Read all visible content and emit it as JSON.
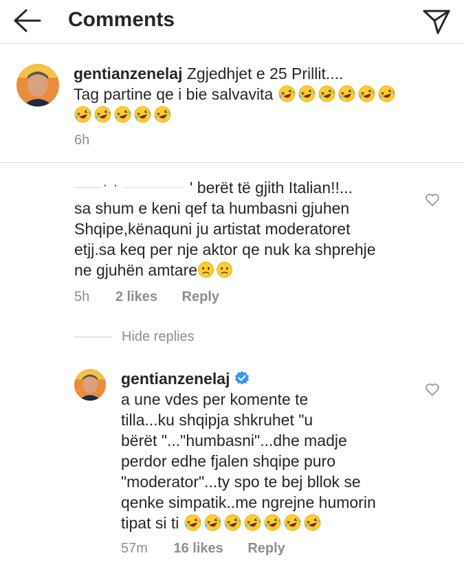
{
  "header": {
    "title": "Comments",
    "back_icon": "back-arrow-icon",
    "share_icon": "direct-send-icon"
  },
  "caption": {
    "username": "gentianzenelaj",
    "text_line1": "Zgjedhjet e 25 Prillit....",
    "text_line2": "Tag partine qe i bie salvavita",
    "laugh_emoji_count_line2": 6,
    "laugh_emoji_count_line3": 5,
    "time": "6h"
  },
  "comment": {
    "line1": "' berët të gjith Italian!!...",
    "line2": "sa shum e keni qef ta humbasni gjuhen",
    "line3": "Shqipe,kënaquni ju artistat moderatoret",
    "line4": "etjj.sa keq per  nje aktor  qe nuk ka shprehje",
    "line5": "ne gjuhën amtare",
    "sad_emoji_count": 2,
    "time": "5h",
    "likes": "2 likes",
    "reply_label": "Reply"
  },
  "hide_replies_label": "Hide replies",
  "reply": {
    "username": "gentianzenelaj",
    "verified": true,
    "lines": [
      "a une vdes per komente te",
      "tilla...ku shqipja shkruhet \"u",
      "bërët \"...\"humbasni\"...dhe madje",
      "perdor edhe fjalen shqipe puro",
      "\"moderator\"...ty spo te bej bllok se",
      "qenke simpatik..me ngrejne humorin"
    ],
    "last_line": "tipat si ti",
    "laugh_emoji_count": 7,
    "time": "57m",
    "likes": "16 likes",
    "reply_label": "Reply"
  },
  "colors": {
    "text": "#262626",
    "secondary": "#8e8e8e",
    "divider": "#dbdbdb",
    "verified_blue": "#3897f0",
    "emoji_yellow": "#ffcc33"
  }
}
